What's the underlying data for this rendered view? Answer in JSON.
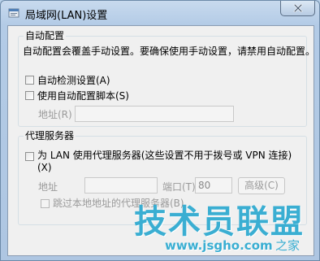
{
  "window": {
    "title": "局域网(LAN)设置"
  },
  "auto_config": {
    "legend": "自动配置",
    "description": "自动配置会覆盖手动设置。要确保使用手动设置，请禁用自动配置。",
    "auto_detect": {
      "label": "自动检测设置(A)",
      "checked": false
    },
    "use_script": {
      "label": "使用自动配置脚本(S)",
      "checked": false
    },
    "address": {
      "label": "地址(R)",
      "value": ""
    }
  },
  "proxy": {
    "legend": "代理服务器",
    "use_proxy": {
      "label_line1": "为 LAN 使用代理服务器(这些设置不用于拨号或 VPN 连接)",
      "label_line2": "(X)",
      "checked": false
    },
    "address": {
      "label": "地址",
      "value": ""
    },
    "port": {
      "label": "端口(T):",
      "value": "80"
    },
    "advanced_label": "高级(C)",
    "bypass_local": {
      "label": "跳过本地地址的代理服务器(B)",
      "checked": false
    }
  },
  "watermark": {
    "text": "技术员联盟",
    "url": "www.jsgho.com",
    "tail": "之家"
  },
  "colors": {
    "watermark": "#3aaed2",
    "client_bg": "#f0f0f0",
    "title_bg": "#b9d1ea"
  }
}
